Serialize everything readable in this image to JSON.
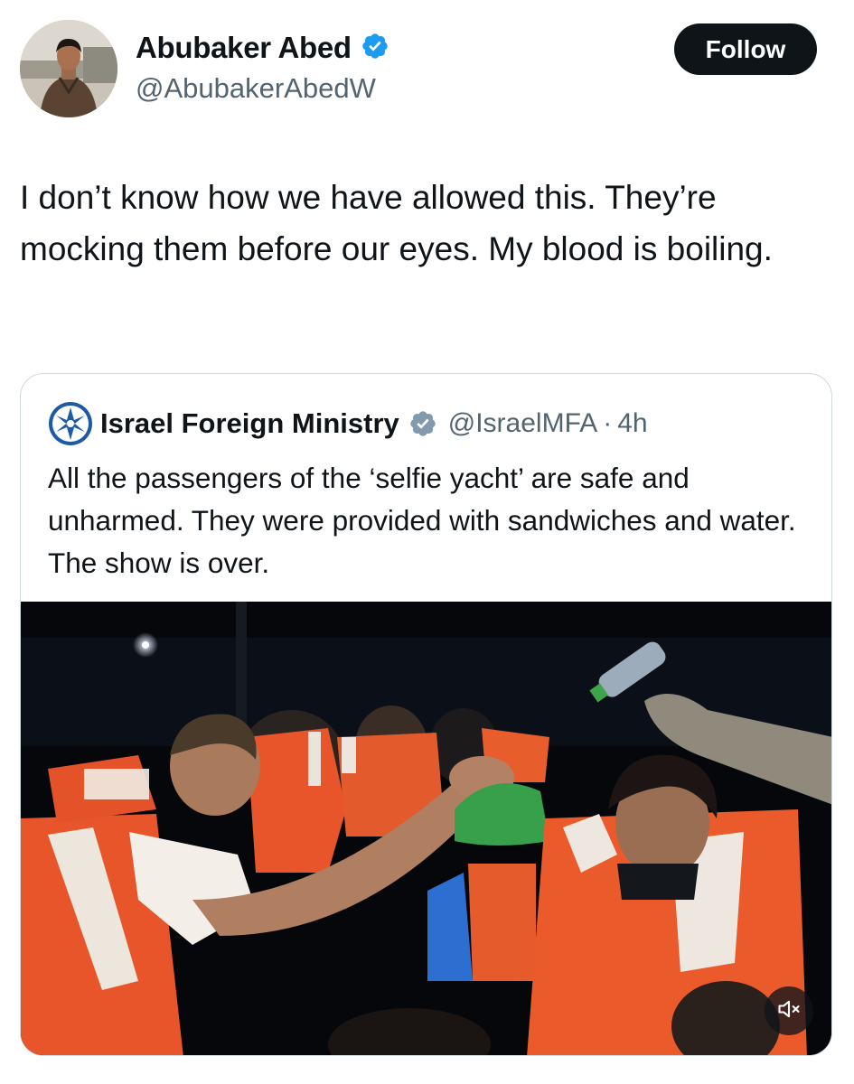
{
  "author": {
    "display_name": "Abubaker Abed",
    "handle": "@AbubakerAbedW",
    "verified_icon": "verified-badge-icon"
  },
  "follow_button": {
    "label": "Follow"
  },
  "tweet": {
    "text": "I don’t know how we have allowed this. They’re mocking them before our eyes. My blood is boiling."
  },
  "quoted_tweet": {
    "display_name": "Israel Foreign Ministry",
    "handle": "@IsraelMFA",
    "separator": "·",
    "time": "4h",
    "verified_icon": "government-badge-icon",
    "text": "All the passengers of the ‘selfie yacht’ are safe and unharmed. They were provided with sandwiches and water. The show is over.",
    "media": {
      "type": "video",
      "muted_icon": "speaker-muted-icon"
    }
  },
  "colors": {
    "text_primary": "#0f1419",
    "text_secondary": "#536471",
    "verified_blue": "#1d9bf0",
    "gov_gray": "#829aab",
    "follow_bg": "#0f1419",
    "card_border": "#cfd9de",
    "life_vest_orange": "#e8552a"
  }
}
